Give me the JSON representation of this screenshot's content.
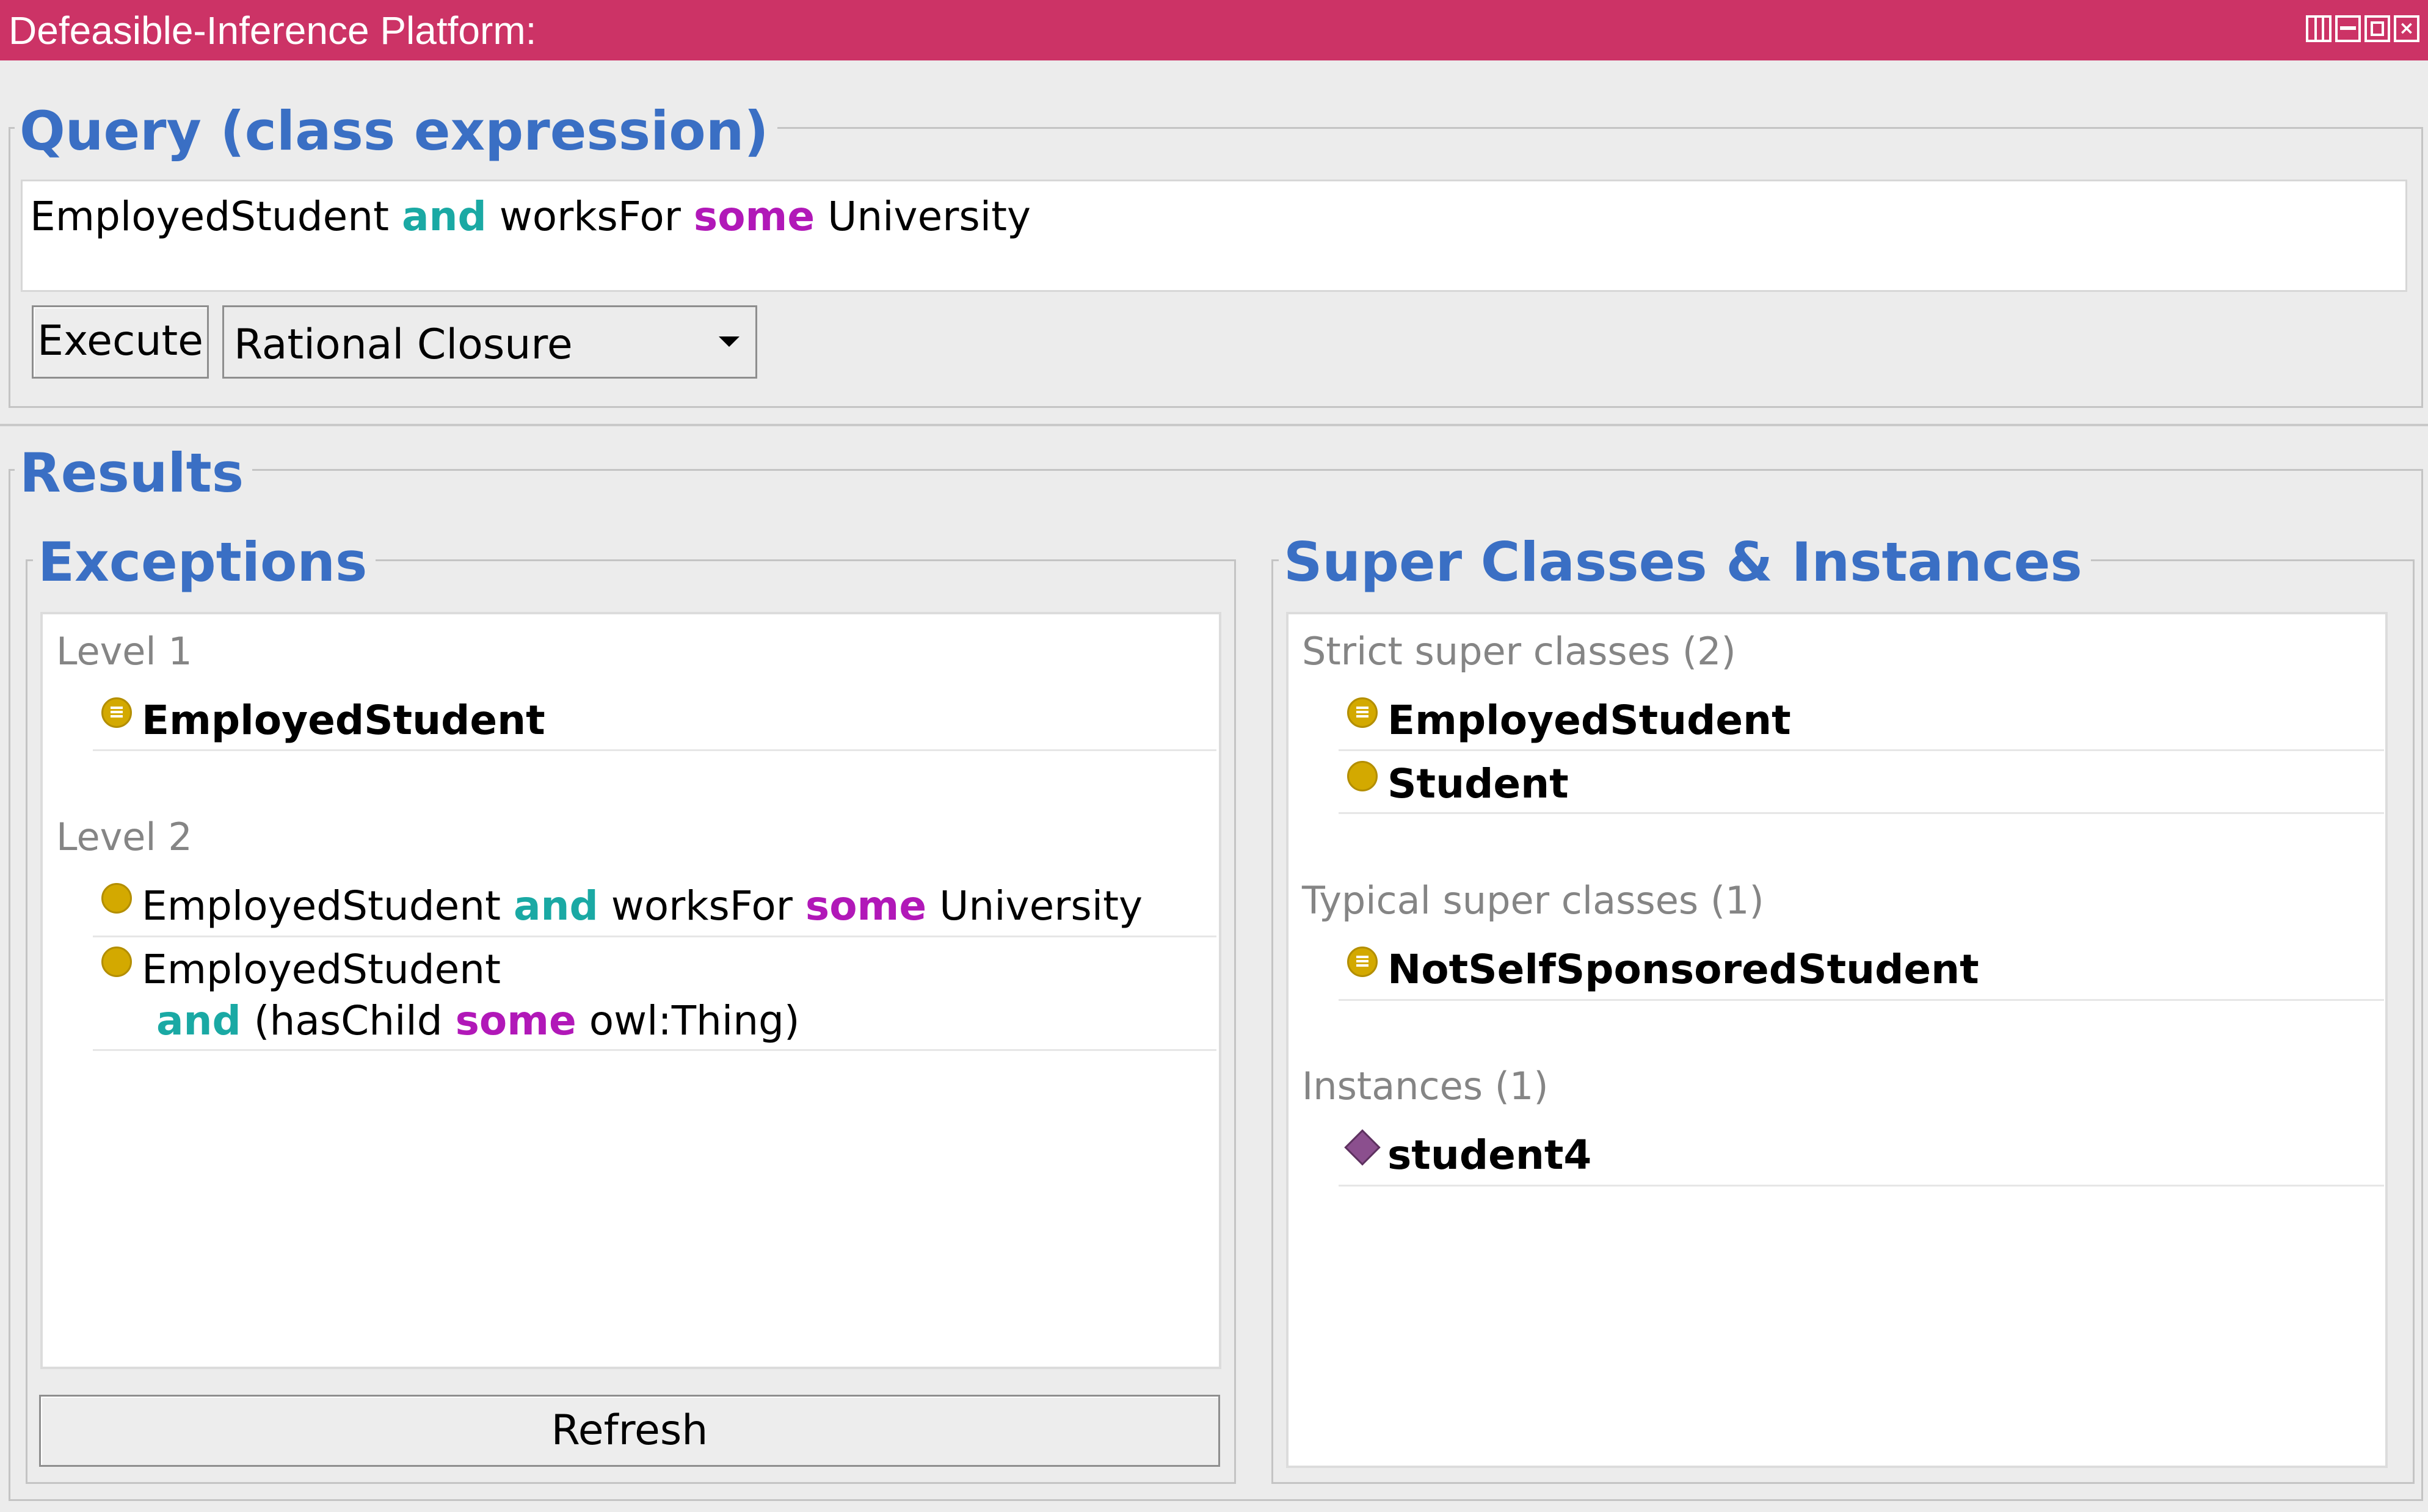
{
  "window": {
    "title": "Defeasible-Inference Platform:"
  },
  "query": {
    "legend": "Query (class expression)",
    "expression": [
      {
        "text": "EmployedStudent "
      },
      {
        "text": "and",
        "kw": "and"
      },
      {
        "text": " worksFor "
      },
      {
        "text": "some",
        "kw": "some"
      },
      {
        "text": " University"
      }
    ],
    "execute_label": "Execute",
    "reasoner_selected": "Rational Closure"
  },
  "results": {
    "legend": "Results",
    "exceptions": {
      "legend": "Exceptions",
      "level1": {
        "header": "Level 1",
        "item1": "EmployedStudent"
      },
      "level2": {
        "header": "Level 2",
        "item1": {
          "a": "EmployedStudent ",
          "and": "and",
          "b": " worksFor ",
          "some": "some",
          "c": " University"
        },
        "item2": {
          "line1": "EmployedStudent",
          "and": "and",
          "b": " (hasChild ",
          "some": "some",
          "c": " owl:Thing)"
        }
      },
      "refresh_label": "Refresh"
    },
    "superclasses": {
      "legend": "Super Classes & Instances",
      "strict_header": "Strict super classes (2)",
      "strict": [
        "EmployedStudent",
        "Student"
      ],
      "typical_header": "Typical super classes (1)",
      "typical": [
        "NotSelfSponsoredStudent"
      ],
      "instances_header": "Instances (1)",
      "instances": [
        "student4"
      ]
    }
  },
  "colors": {
    "titlebar": "#cc3366",
    "heading": "#3a6fc4",
    "keyword_and": "#1aa9a4",
    "keyword_some": "#b118b8",
    "class_icon": "#d3a900",
    "individual_icon": "#8b4f8e"
  }
}
